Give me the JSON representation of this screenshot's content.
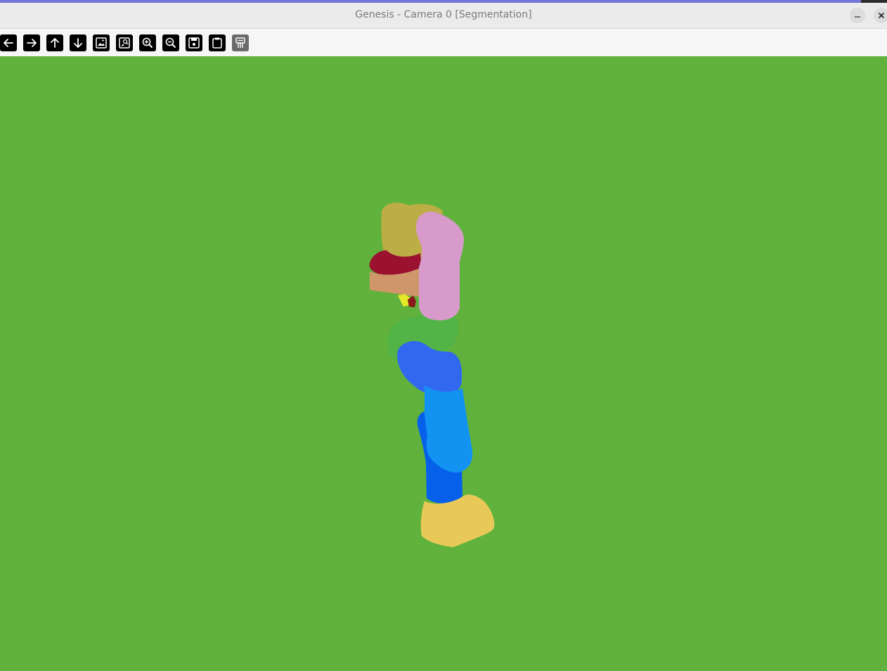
{
  "window": {
    "title": "Genesis - Camera 0 [Segmentation]",
    "minimize_icon": "minimize-icon",
    "close_icon": "close-icon"
  },
  "toolbar": {
    "buttons": [
      {
        "name": "back-button",
        "icon": "arrow-left-icon"
      },
      {
        "name": "forward-button",
        "icon": "arrow-right-icon"
      },
      {
        "name": "up-button",
        "icon": "arrow-up-icon"
      },
      {
        "name": "down-button",
        "icon": "arrow-down-icon"
      },
      {
        "name": "image-button",
        "icon": "image-icon"
      },
      {
        "name": "image-zoom-button",
        "icon": "image-search-icon"
      },
      {
        "name": "zoom-in-button",
        "icon": "zoom-in-icon"
      },
      {
        "name": "zoom-out-button",
        "icon": "zoom-out-icon"
      },
      {
        "name": "save-button",
        "icon": "save-icon"
      },
      {
        "name": "clipboard-button",
        "icon": "clipboard-icon"
      },
      {
        "name": "settings-button",
        "icon": "settings-icon"
      }
    ]
  },
  "viewport": {
    "background_color": "#60b23c",
    "segments": [
      {
        "name": "head-segment",
        "color": "#bcae44"
      },
      {
        "name": "collar-segment",
        "color": "#9a1230"
      },
      {
        "name": "arm-upper-segment",
        "color": "#d79acb"
      },
      {
        "name": "forearm-segment",
        "color": "#cf966a"
      },
      {
        "name": "hand-segment",
        "color": "#e4e826"
      },
      {
        "name": "hand-detail-segment",
        "color": "#8a1a1a"
      },
      {
        "name": "torso-segment",
        "color": "#52b446"
      },
      {
        "name": "hip-segment",
        "color": "#3268ef"
      },
      {
        "name": "thigh-segment",
        "color": "#1293f2"
      },
      {
        "name": "shin-segment",
        "color": "#0660ea"
      },
      {
        "name": "foot-segment",
        "color": "#e8c958"
      }
    ]
  }
}
